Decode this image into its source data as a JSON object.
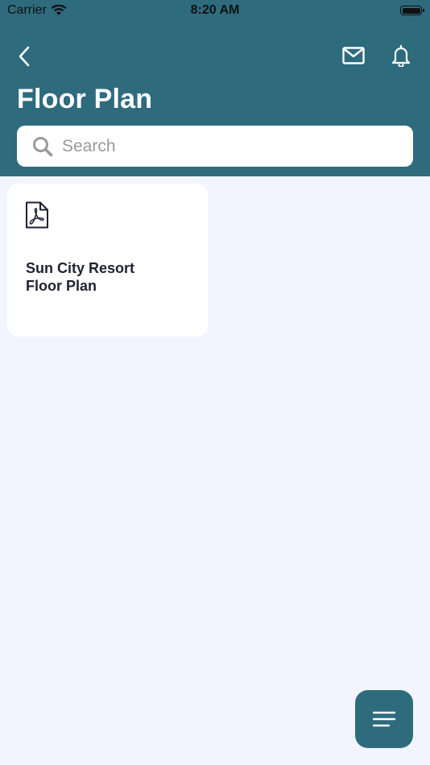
{
  "status_bar": {
    "carrier": "Carrier",
    "time": "8:20 AM"
  },
  "header": {
    "title": "Floor Plan",
    "back_icon": "chevron-left-icon",
    "mail_icon": "envelope-icon",
    "bell_icon": "bell-icon"
  },
  "search": {
    "placeholder": "Search",
    "value": ""
  },
  "documents": [
    {
      "title": "Sun City Resort\nFloor Plan",
      "icon": "pdf-file-icon"
    }
  ],
  "fab": {
    "icon": "menu-icon"
  },
  "colors": {
    "header": "#2e6b7d",
    "background": "#f2f5fd",
    "card": "#ffffff",
    "title_text": "#1e2130"
  }
}
